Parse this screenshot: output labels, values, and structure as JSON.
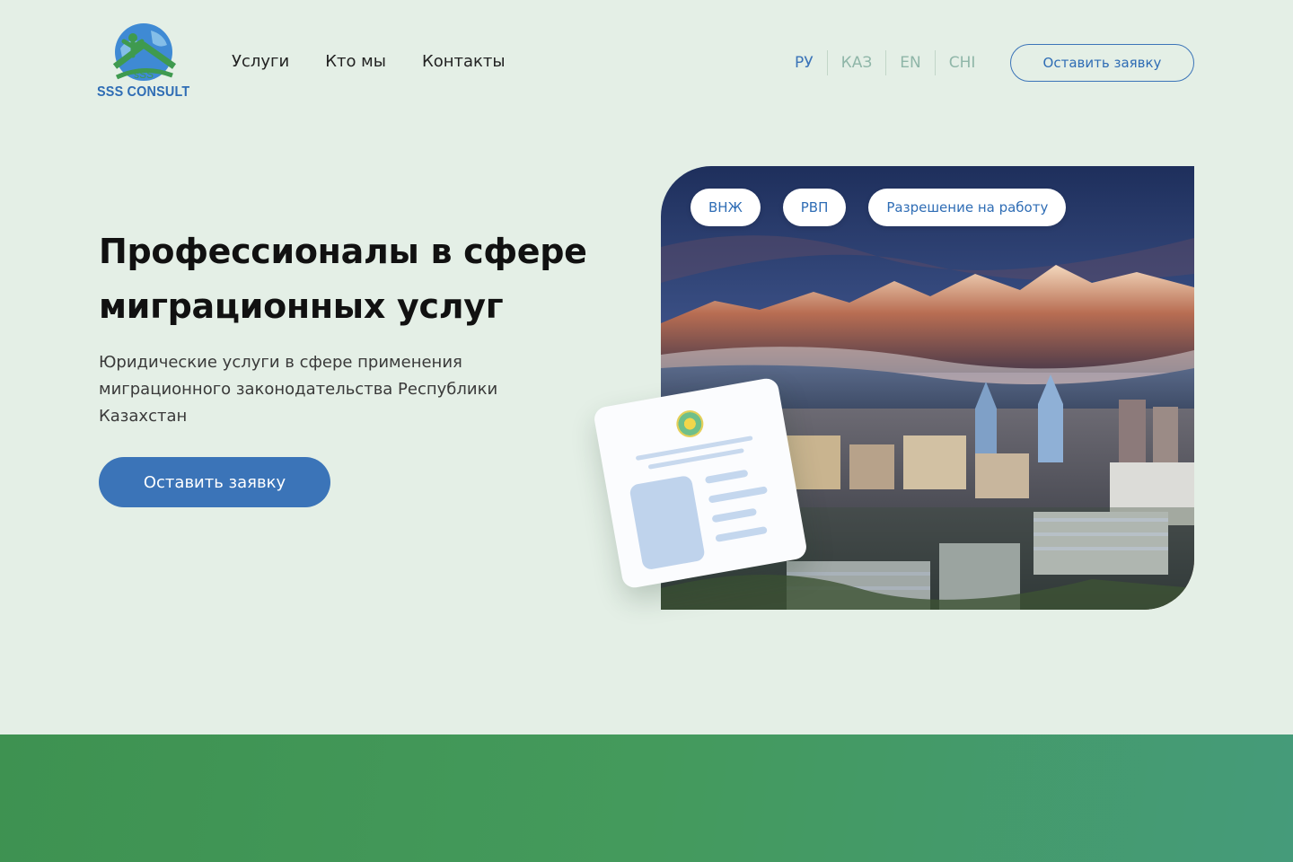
{
  "header": {
    "logo": {
      "icon": "globe-house-logo-icon",
      "text": "SSS CONSULT",
      "mark": "sSS"
    },
    "nav": [
      "Услуги",
      "Кто мы",
      "Контакты"
    ],
    "languages": [
      {
        "label": "РУ",
        "active": true
      },
      {
        "label": "КАЗ",
        "active": false
      },
      {
        "label": "EN",
        "active": false
      },
      {
        "label": "CHI",
        "active": false
      }
    ],
    "cta_label": "Оставить заявку"
  },
  "hero": {
    "title_line1": "Профессионалы в сфере",
    "title_line2": "миграционных услуг",
    "subtitle_line1": "Юридические услуги в сфере применения",
    "subtitle_line2": "миграционного законодательства Республики",
    "subtitle_line3": "Казахстан",
    "cta_label": "Оставить заявку",
    "chips": [
      "ВНЖ",
      "РВП",
      "Разрешение на работу"
    ]
  },
  "colors": {
    "background": "#e4efe6",
    "accent": "#3b74b8",
    "band_green": "#449a5c"
  }
}
